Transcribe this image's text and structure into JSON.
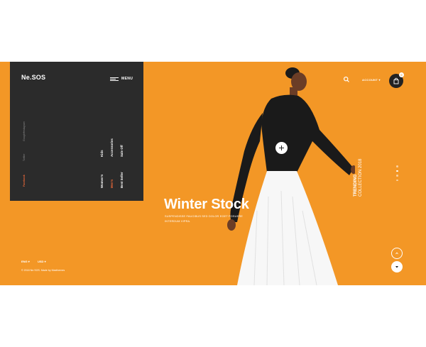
{
  "brand": {
    "logo": "Ne.SOS"
  },
  "nav": {
    "menu_label": "MENU"
  },
  "social": [
    "Facebook",
    "Twitter",
    "Google+",
    "Instagram"
  ],
  "categories": [
    "Women's",
    "Kids",
    "Men's",
    "Accessories",
    "Best Seller",
    "Sale Off"
  ],
  "header": {
    "account_label": "ACCOUNT",
    "cart_count": "0"
  },
  "hero": {
    "headline": "Winter Stock",
    "subtext": "SUSPENDISSE FAUCIBUS SED DOLOR EGET POSUERE INTERDUM VIPRA.",
    "trend_line1": "TRENDING",
    "trend_line2": "COLLECTION 2018"
  },
  "footer": {
    "language": "ENG",
    "currency": "USD",
    "copyright": "© 2018 Ne.SOS. Made by Maxthemes"
  },
  "colors": {
    "accent": "#f39726",
    "panel": "#2b2b2b",
    "highlight": "#f26b3a"
  }
}
